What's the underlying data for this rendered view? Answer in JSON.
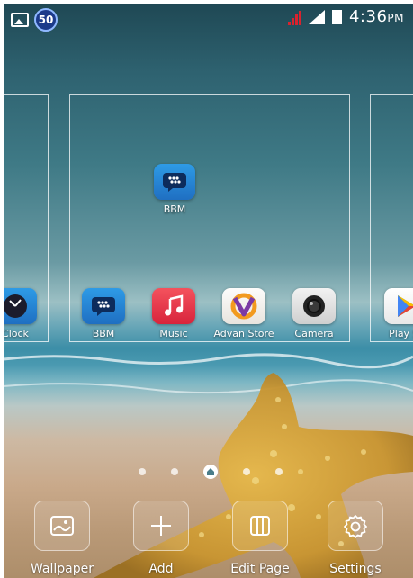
{
  "status_bar": {
    "battery_level": "50",
    "time": "4:36",
    "time_suffix": "PM"
  },
  "page_center": {
    "apps": [
      {
        "label": "BBM",
        "icon": "bbm-icon"
      }
    ]
  },
  "preview_row": {
    "apps": [
      {
        "label": "Clock",
        "icon": "clock-icon"
      },
      {
        "label": "BBM",
        "icon": "bbm-icon"
      },
      {
        "label": "Music",
        "icon": "music-note-icon"
      },
      {
        "label": "Advan Store",
        "icon": "advan-store-icon"
      },
      {
        "label": "Camera",
        "icon": "camera-icon"
      },
      {
        "label": "Play St",
        "icon": "play-store-icon"
      }
    ]
  },
  "pager": {
    "total": 5,
    "active": 3
  },
  "dock": {
    "wallpaper_label": "Wallpaper",
    "add_label": "Add",
    "edit_page_label": "Edit Page",
    "settings_label": "Settings"
  },
  "colors": {
    "bbm_blue": "#1f6fc2",
    "music_red": "#e0303f",
    "signal_red": "#d9232e"
  }
}
